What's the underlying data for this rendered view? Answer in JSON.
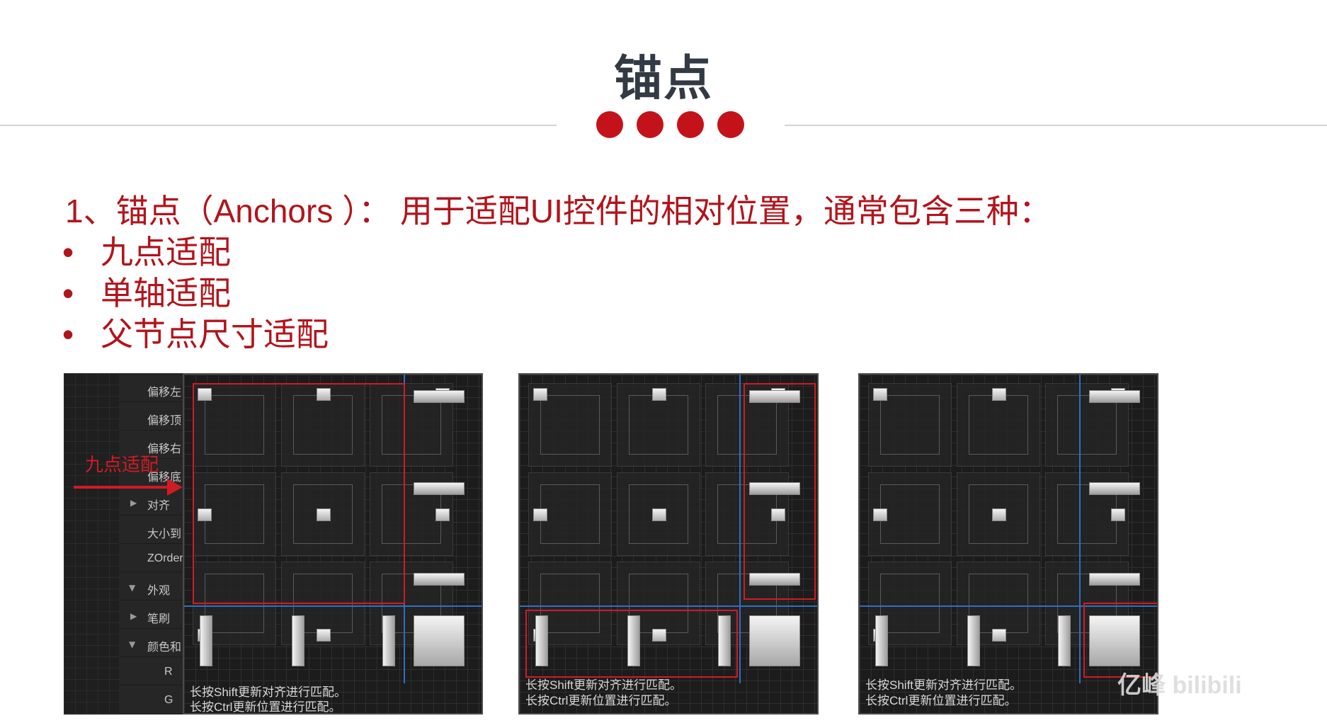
{
  "title": "锚点",
  "intro": "1、锚点（Anchors ）：  用于适配UI控件的相对位置，通常包含三种：",
  "bullets": [
    {
      "mark": "•",
      "text": "九点适配"
    },
    {
      "mark": "•",
      "text": "单轴适配"
    },
    {
      "mark": "•",
      "text": "父节点尺寸适配"
    }
  ],
  "sidebar": {
    "labels": [
      "偏移左",
      "偏移顶",
      "偏移右",
      "偏移底",
      "对齐",
      "大小到",
      "ZOrder",
      "外观",
      "笔刷",
      "颜色和",
      "R",
      "G"
    ]
  },
  "annotation": "九点适配",
  "hints": {
    "line1": "长按Shift更新对齐进行匹配。",
    "line2": "长按Ctrl更新位置进行匹配。"
  },
  "watermark": "亿峰 bilibili",
  "colors": {
    "accent_red": "#c4121b",
    "title_gray": "#333a44",
    "panel_bg": "#1c1c1c",
    "divider_blue": "#2f6fc0"
  }
}
